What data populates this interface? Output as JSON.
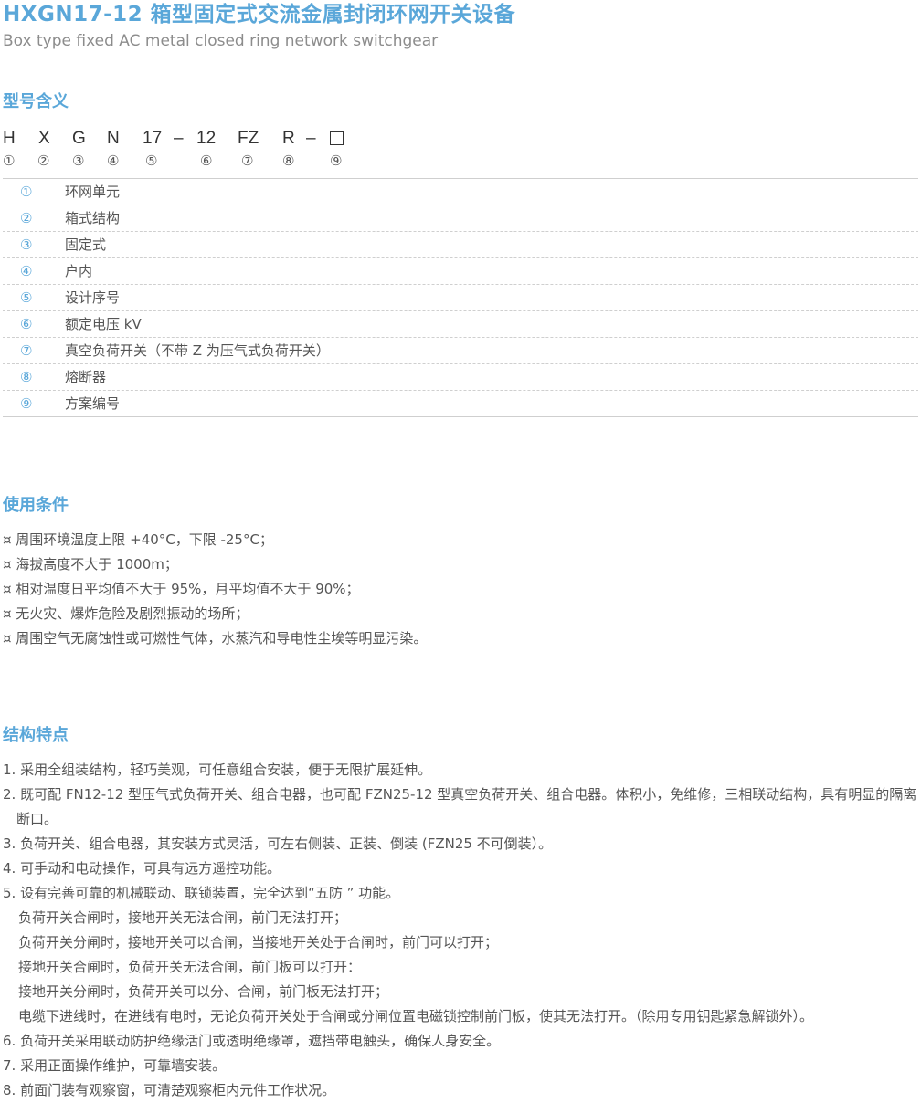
{
  "title": "HXGN17-12 箱型固定式交流金属封闭环网开关设备",
  "subtitle": "Box type fixed AC metal closed ring network switchgear",
  "model_section": {
    "heading": "型号含义",
    "code": [
      "H",
      "X",
      "G",
      "N",
      "17",
      "–",
      "12",
      "FZ",
      "R",
      "–"
    ],
    "code_numbers": [
      "①",
      "②",
      "③",
      "④",
      "⑤",
      "⑥",
      "⑦",
      "⑧",
      "⑨"
    ],
    "definitions": [
      {
        "num": "①",
        "text": "环网单元"
      },
      {
        "num": "②",
        "text": "箱式结构"
      },
      {
        "num": "③",
        "text": "固定式"
      },
      {
        "num": "④",
        "text": "户内"
      },
      {
        "num": "⑤",
        "text": "设计序号"
      },
      {
        "num": "⑥",
        "text": "额定电压 kV"
      },
      {
        "num": "⑦",
        "text": "真空负荷开关（不带 Z 为压气式负荷开关）"
      },
      {
        "num": "⑧",
        "text": "熔断器"
      },
      {
        "num": "⑨",
        "text": "方案编号"
      }
    ]
  },
  "conditions_section": {
    "heading": "使用条件",
    "items": [
      "¤ 周围环境温度上限 +40°C，下限 -25°C；",
      "¤ 海拔高度不大于 1000m；",
      "¤ 相对温度日平均值不大于 95%，月平均值不大于 90%；",
      "¤ 无火灾、爆炸危险及剧烈振动的场所；",
      "¤ 周围空气无腐蚀性或可燃性气体，水蒸汽和导电性尘埃等明显污染。"
    ]
  },
  "structure_section": {
    "heading": "结构特点",
    "items": [
      "1. 采用全组装结构，轻巧美观，可任意组合安装，便于无限扩展延伸。",
      "2. 既可配 FN12-12 型压气式负荷开关、组合电器，也可配 FZN25-12 型真空负荷开关、组合电器。体积小，免维修，三相联动结构，具有明显的隔离断口。",
      "3. 负荷开关、组合电器，其安装方式灵活，可左右侧装、正装、倒装 (FZN25 不可倒装）。",
      "4. 可手动和电动操作，可具有远方遥控功能。",
      "5. 设有完善可靠的机械联动、联锁装置，完全达到“五防 ” 功能。",
      "负荷开关合闸时，接地开关无法合闸，前门无法打开；",
      "负荷开关分闸时，接地开关可以合闸，当接地开关处于合闸时，前门可以打开；",
      "接地开关合闸时，负荷开关无法合闸，前门板可以打开：",
      "接地开关分闸时，负荷开关可以分、合闸，前门板无法打开；",
      "电缆下进线时，在进线有电时，无论负荷开关处于合闸或分闸位置电磁锁控制前门板，使其无法打开。（除用专用钥匙紧急解锁外）。",
      "6. 负荷开关采用联动防护绝缘活门或透明绝缘罩，遮挡带电触头，确保人身安全。",
      "7. 采用正面操作维护，可靠墙安装。",
      "8. 前面门装有观察窗，可清楚观察柜内元件工作状况。"
    ]
  }
}
